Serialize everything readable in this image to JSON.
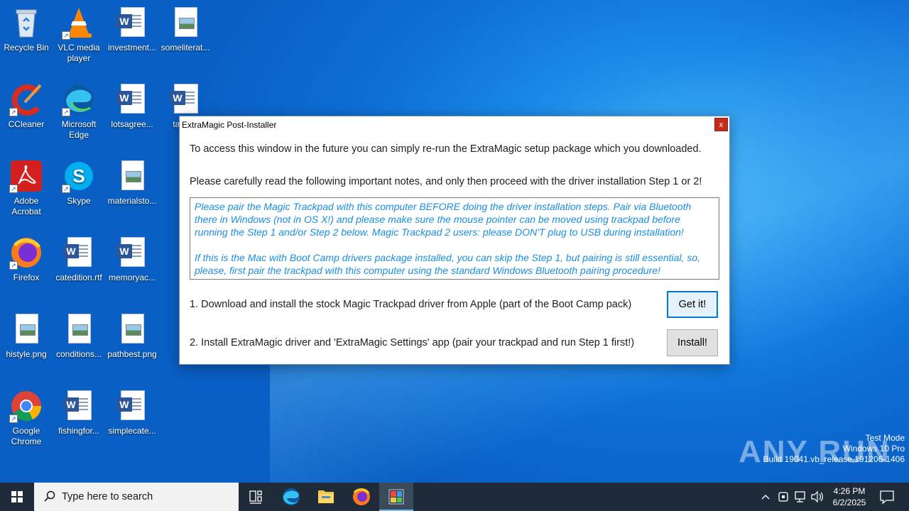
{
  "desktop": {
    "icons": [
      {
        "label": "Recycle Bin"
      },
      {
        "label": "VLC media player"
      },
      {
        "label": "investment..."
      },
      {
        "label": "someliterat..."
      },
      {
        "label": "CCleaner"
      },
      {
        "label": "Microsoft Edge"
      },
      {
        "label": "lotsagree..."
      },
      {
        "label": "takin..."
      },
      {
        "label": "Adobe Acrobat"
      },
      {
        "label": "Skype"
      },
      {
        "label": "materialsto..."
      },
      {
        "label": "Firefox"
      },
      {
        "label": "catedition.rtf"
      },
      {
        "label": "memoryac..."
      },
      {
        "label": "histyle.png"
      },
      {
        "label": "conditions..."
      },
      {
        "label": "pathbest.png"
      },
      {
        "label": "Google Chrome"
      },
      {
        "label": "fishingfor..."
      },
      {
        "label": "simplecate..."
      }
    ]
  },
  "dialog": {
    "title": "ExtraMagic Post-Installer",
    "close_label": "x",
    "intro": "To access this window in the future you can simply re-run the ExtraMagic setup package which you downloaded.",
    "instruction": "Please carefully read the following important notes, and only then proceed with the driver installation Step 1 or 2!",
    "notes": [
      "Please pair the Magic Trackpad with this computer BEFORE doing the driver installation steps. Pair via Bluetooth there in Windows (not in OS X!) and please make sure the mouse pointer can be moved using trackpad before running the Step 1 and/or Step 2 below. Magic Trackpad 2 users: please DON'T plug to USB during installation!",
      "If this is the Mac with Boot Camp drivers package installed, you can skip the Step 1, but pairing is still essential, so, please, first pair the trackpad with this computer using the standard Windows Bluetooth pairing procedure!"
    ],
    "step1": "1. Download and install the stock Magic Trackpad driver from Apple (part of the Boot Camp pack)",
    "step1_button": "Get it!",
    "step2": "2. Install ExtraMagic driver and 'ExtraMagic Settings' app (pair your trackpad and run Step 1 first!)",
    "step2_button": "Install!"
  },
  "watermark": {
    "brand": "ANY RUN",
    "line1": "Test Mode",
    "line2": "Windows 10 Pro",
    "line3": "Build 19041.vb_release.191206-1406"
  },
  "taskbar": {
    "search_placeholder": "Type here to search",
    "time": "4:26 PM",
    "date": "6/2/2025"
  },
  "colors": {
    "notes_text": "#1a8ee0",
    "taskbar_bg": "#1f2b38",
    "close_button": "#c42b1c"
  }
}
